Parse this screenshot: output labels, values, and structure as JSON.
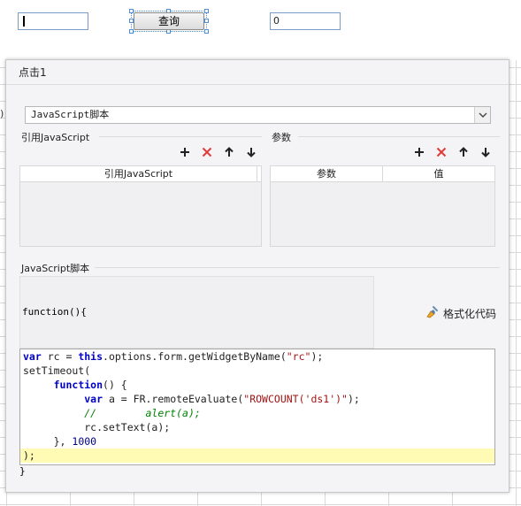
{
  "designer": {
    "top_number_value": "0",
    "query_button_label": "查询",
    "left_paren": ")"
  },
  "dialog": {
    "title": "点击1",
    "type_select": {
      "value": "JavaScript脚本"
    },
    "ref_section": {
      "label": "引用JavaScript",
      "table_header": "引用JavaScript"
    },
    "params_section": {
      "label": "参数",
      "columns": [
        "参数",
        "值"
      ]
    },
    "script_section": {
      "label": "JavaScript脚本",
      "function_header": "function(){",
      "format_button_label": "格式化代码",
      "closing_brace": "}",
      "code_lines": [
        "var rc = this.options.form.getWidgetByName(\"rc\");",
        "setTimeout(",
        "     function() {",
        "          var a = FR.remoteEvaluate(\"ROWCOUNT('ds1')\");",
        "          //        alert(a);",
        "          rc.setText(a);",
        "     }, 1000",
        ");"
      ]
    }
  },
  "colors": {
    "delete_icon": "#e03c3c",
    "keyword": "#0000c8",
    "string": "#a31515",
    "comment": "#008000",
    "highlight_line": "#fffbb5"
  },
  "icons": {
    "add": "plus-icon",
    "delete": "delete-x-icon",
    "up": "arrow-up-icon",
    "down": "arrow-down-icon",
    "dropdown": "chevron-down-icon",
    "format": "broom-icon"
  }
}
